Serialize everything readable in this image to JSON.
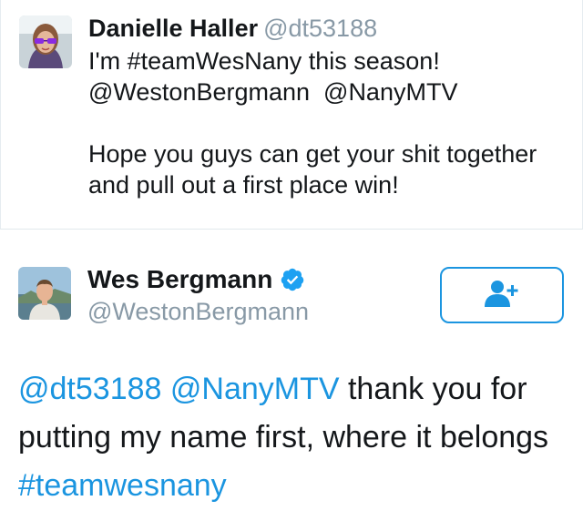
{
  "reply_tweet": {
    "author_name": "Danielle Haller",
    "author_handle": "@dt53188",
    "text": "I'm #teamWesNany this season!\n@WestonBergmann  @NanyMTV\n\nHope you guys can get your shit together\nand pull out a first place win!"
  },
  "main_tweet": {
    "author_name": "Wes Bergmann",
    "author_handle": "@WestonBergmann",
    "verified_icon": "verified-badge-icon",
    "follow_icon": "follow-user-plus-icon",
    "text_parts": {
      "mention_1": "@dt53188",
      "mention_2": "@NanyMTV",
      "body": " thank you for putting my name first, where it belongs ",
      "hashtag": "#teamwesnany"
    }
  },
  "colors": {
    "link": "#1b95e0",
    "muted": "#8899a6",
    "text": "#14171a",
    "divider": "#e1e8ed"
  }
}
